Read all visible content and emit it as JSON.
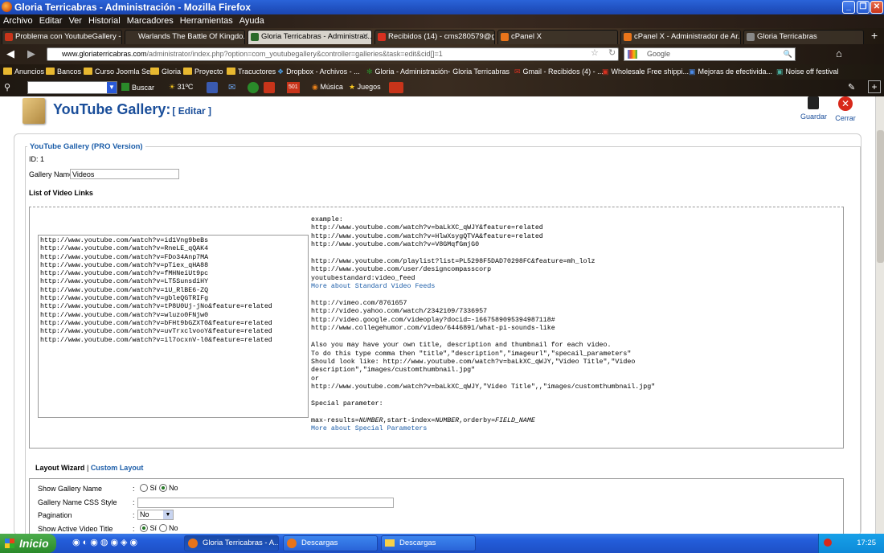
{
  "window": {
    "title": "Gloria Terricabras - Administración - Mozilla Firefox"
  },
  "menu": [
    "Archivo",
    "Editar",
    "Ver",
    "Historial",
    "Marcadores",
    "Herramientas",
    "Ayuda"
  ],
  "tabs": [
    {
      "label": "Problema con YoutubeGallery - ...",
      "color": "#c8341a"
    },
    {
      "label": "Warlands The Battle Of Kingdo...",
      "color": "#555"
    },
    {
      "label": "Gloria Terricabras - Administrac...",
      "color": "#2a6a2a",
      "active": true
    },
    {
      "label": "Recibidos (14) - cms280579@g...",
      "color": "#d83020"
    },
    {
      "label": "cPanel X",
      "color": "#e8741a"
    },
    {
      "label": "cPanel X - Administrador de Ar...",
      "color": "#e8741a"
    },
    {
      "label": "Gloria Terricabras",
      "color": "#888"
    }
  ],
  "nav": {
    "url_domain": "www.gloriaterricabras.com",
    "url_path": "/administrator/index.php?option=com_youtubegallery&controller=galleries&task=edit&cid[]=1",
    "search_placeholder": "Google"
  },
  "bookmarks": [
    "Anuncios",
    "Bancos",
    "Curso Joomla Seo",
    "Gloria",
    "Proyecto",
    "Tracuctores",
    "Dropbox - Archivos - ...",
    "Gloria - Administración",
    "Gloria Terricabras",
    "Gmail - Recibidos (4) - ...",
    "Wholesale Free shippi...",
    "Mejoras de efectivida...",
    "Noise off festival"
  ],
  "toolbar2": {
    "search_label": "Buscar",
    "weather": "31ºC",
    "music": "Música",
    "games": "Juegos",
    "badge": "501"
  },
  "header": {
    "title": "YouTube Gallery:",
    "subtitle": "[ Editar ]",
    "save_label": "Guardar",
    "close_label": "Cerrar"
  },
  "form": {
    "legend": "YouTube Gallery (PRO Version)",
    "id_label": "ID: 1",
    "gallery_name_label": "Gallery Name",
    "gallery_name_value": "Videos",
    "video_links_heading": "List of Video Links",
    "video_links": "http://www.youtube.com/watch?v=id1Vng9beBs\nhttp://www.youtube.com/watch?v=RneLE_qQAK4\nhttp://www.youtube.com/watch?v=FDo34Anp7MA\nhttp://www.youtube.com/watch?v=pTiex_qHA88\nhttp://www.youtube.com/watch?v=fMHNeiUt9pc\nhttp://www.youtube.com/watch?v=LT5SunsdiHY\nhttp://www.youtube.com/watch?v=1U_RlBE6-ZQ\nhttp://www.youtube.com/watch?v=gbleQGTRIFg\nhttp://www.youtube.com/watch?v=tP8U0Uj-jNo&feature=related\nhttp://www.youtube.com/watch?v=wluzo0FNjw0\nhttp://www.youtube.com/watch?v=bFHt9bGZXT0&feature=related\nhttp://www.youtube.com/watch?v=uvTrxclvooY&feature=related\nhttp://www.youtube.com/watch?v=il7ocxnV-l0&feature=related",
    "example_1": "example:\nhttp://www.youtube.com/watch?v=baLkXC_qWJY&feature=related\nhttp://www.youtube.com/watch?v=HlwXsygQTVA&feature=related\nhttp://www.youtube.com/watch?v=V8GMqfGmjG0\n\nhttp://www.youtube.com/playlist?list=PL5298F5DAD70298FC&feature=mh_lolz\nhttp://www.youtube.com/user/designcompasscorp\nyoutubestandard:video_feed",
    "link_standard_feeds": "More about Standard Video Feeds",
    "example_2": "http://vimeo.com/8761657\nhttp://video.yahoo.com/watch/2342109/7336957\nhttp://video.google.com/videoplay?docid=-1667589095394987118#\nhttp://www.collegehumor.com/video/6446891/what-pi-sounds-like\n\nAlso you may have your own title, description and thumbnail for each video.\nTo do this type comma then \"title\",\"description\",\"imageurl\",\"specail_parameters\"\nShould look like: http://www.youtube.com/watch?v=baLkXC_qWJY,\"Video Title\",\"Video\ndescription\",\"images/customthumbnail.jpg\"\nor\nhttp://www.youtube.com/watch?v=baLkXC_qWJY,\"Video Title\",,\"images/customthumbnail.jpg\"\n\nSpecial parameter:\n\n",
    "example_3_prefix": "max-results=",
    "example_3_n1": "NUMBER",
    "example_3_mid": ",start-index=",
    "example_3_n2": "NUMBER",
    "example_3_mid2": ",orderby=",
    "example_3_f": "FIELD_NAME",
    "link_special": "More about Special Parameters",
    "layout_wizard": "Layout Wizard",
    "separator": "|",
    "custom_layout": "Custom Layout",
    "rows": [
      {
        "label": "Show Gallery Name",
        "type": "radio",
        "opt1": "Sí",
        "opt2": "No",
        "selected": "No"
      },
      {
        "label": "Gallery Name CSS Style",
        "type": "text",
        "value": ""
      },
      {
        "label": "Pagination",
        "type": "select",
        "value": "No"
      },
      {
        "label": "Show Active Video Title",
        "type": "radio",
        "opt1": "Sí",
        "opt2": "No",
        "selected": "Sí"
      }
    ],
    "colon": ":"
  },
  "taskbar": {
    "start": "Inicio",
    "tasks": [
      "Gloria Terricabras - A...",
      "Descargas",
      "Descargas"
    ],
    "time": "17:25"
  }
}
